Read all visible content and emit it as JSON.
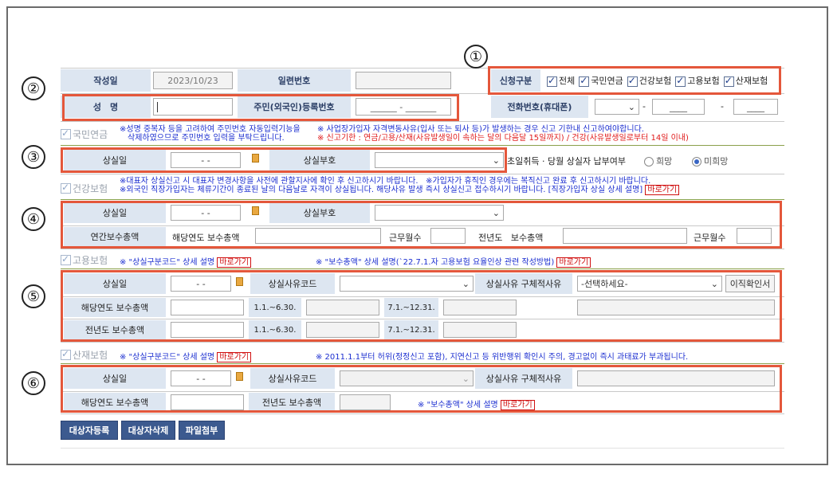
{
  "markers": [
    "①",
    "②",
    "③",
    "④",
    "⑤",
    "⑥"
  ],
  "header": {
    "date_label": "작성일",
    "date_value": "2023/10/23",
    "serial_label": "일련번호",
    "apply_label": "신청구분",
    "apply_options": [
      "전체",
      "국민연금",
      "건강보험",
      "고용보험",
      "산재보험"
    ],
    "name_label": "성　명",
    "rrn_label": "주민(외국인)등록번호",
    "rrn_placeholder": "______ - _______",
    "phone_label": "전화번호(휴대폰)",
    "phone_dash": "-",
    "phone_blank": "____"
  },
  "pension": {
    "title": "국민연금",
    "note1a": "※성명 중복자 등을 고려하여 주민번호 자동입력기능을",
    "note1b": "삭제하였으므로 주민번호 입력을 부탁드립니다.",
    "note2a": "※ 사업장가입자 자격변동사유(입사 또는 퇴사 등)가 발생하는 경우 신고 기한내 신고하여야합니다.",
    "note2b": "※ 신고기한 : 연금/고용/산재(사유발생일이 속하는 달의 다음달 15일까지) / 건강(사유발생일로부터 14일 이내)",
    "loss_date_label": "상실일",
    "date_blank": "-  -",
    "loss_code_label": "상실부호",
    "payment_label": "초일취득 · 당월 상실자 납부여부",
    "opt_yes": "희망",
    "opt_no": "미희망"
  },
  "health": {
    "title": "건강보험",
    "note1": "※대표자 상실신고 시 대표자 변경사항을 사전에 관할지사에 확인 후 신고하시기 바랍니다.",
    "note2": "※가입자가 휴직인 경우에는 복직신고 완료 후 신고하시기 바랍니다.",
    "note3": "※외국인 직장가입자는 체류기간이 종료된 날의 다음날로 자격이 상실됩니다. 해당사유 발생 즉시 상실신고 접수하시기 바랍니다. [직장가입자 상실 상세 설명]",
    "link": "바로가기",
    "loss_date_label": "상실일",
    "date_blank": "-  -",
    "loss_code_label": "상실부호",
    "annual_label": "연간보수총액",
    "cur_year_label": "해당연도",
    "total_label": "보수총액",
    "months_label": "근무월수",
    "prev_year_label": "전년도"
  },
  "employment": {
    "title": "고용보험",
    "note1": "※ \"상실구분코드\" 상세 설명",
    "note2": "※ \"보수총액\" 상세 설명(`22.7.1.자 고용보험 요율인상 관련 작성방법)",
    "link": "바로가기",
    "loss_date_label": "상실일",
    "date_blank": "-  -",
    "reason_code_label": "상실사유코드",
    "reason_detail_label": "상실사유 구체적사유",
    "select_placeholder": "-선택하세요-",
    "btn_confirm": "이직확인서",
    "cur_total_label": "해당연도 보수총액",
    "prev_total_label": "전년도 보수총액",
    "period1": "1.1.~6.30.",
    "period2": "7.1.~12.31."
  },
  "accident": {
    "title": "산재보험",
    "note1": "※ \"상실구분코드\" 상세 설명",
    "note2": "※ 2011.1.1부터 허위(정정신고 포함), 지연신고 등 위반행위 확인시 주의, 경고없이 즉시 과태료가 부과됩니다.",
    "link": "바로가기",
    "loss_date_label": "상실일",
    "date_blank": "-  -",
    "reason_code_label": "상실사유코드",
    "reason_detail_label": "상실사유 구체적사유",
    "cur_total_label": "해당연도 보수총액",
    "prev_total_label": "전년도 보수총액",
    "note3": "※ \"보수총액\" 상세 설명"
  },
  "actions": {
    "register": "대상자등록",
    "delete": "대상자삭제",
    "attach": "파일첨부"
  }
}
